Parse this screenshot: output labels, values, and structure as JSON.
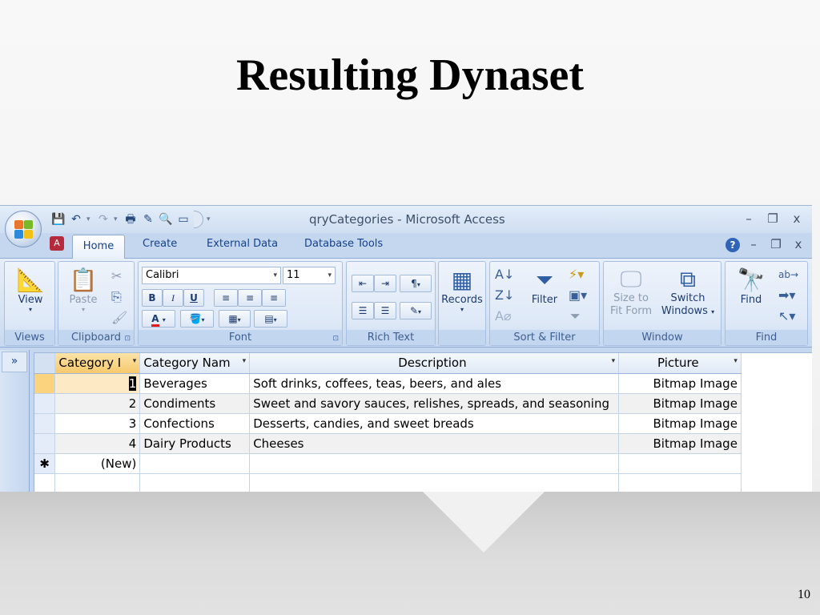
{
  "slide": {
    "title": "Resulting Dynaset",
    "page_number": "10"
  },
  "window": {
    "title": "qryCategories - Microsoft Access",
    "controls": {
      "minimize": "–",
      "restore": "❐",
      "close": "x"
    },
    "doc_controls": {
      "help": "?",
      "minimize": "–",
      "restore": "❐",
      "close": "x"
    }
  },
  "quick_access": {
    "icons": [
      "save-icon",
      "undo-icon",
      "redo-icon",
      "print-icon",
      "design-icon",
      "print-preview-icon",
      "new-icon"
    ],
    "customize_glyph": "▾"
  },
  "tabs": [
    {
      "label": "Home",
      "active": true
    },
    {
      "label": "Create"
    },
    {
      "label": "External Data"
    },
    {
      "label": "Database Tools"
    }
  ],
  "ribbon": {
    "views": {
      "label": "Views",
      "view_button": "View"
    },
    "clipboard": {
      "label": "Clipboard",
      "paste_button": "Paste"
    },
    "font": {
      "label": "Font",
      "font_name": "Calibri",
      "font_size": "11",
      "bold": "B",
      "italic": "I",
      "underline": "U",
      "font_color_glyph": "A"
    },
    "rich_text": {
      "label": "Rich Text"
    },
    "records": {
      "label": "",
      "records_button": "Records"
    },
    "sort_filter": {
      "label": "Sort & Filter",
      "filter_button": "Filter"
    },
    "window": {
      "label": "Window",
      "size_to_fit_line1": "Size to",
      "size_to_fit_line2": "Fit Form",
      "switch_line1": "Switch",
      "switch_line2": "Windows"
    },
    "find": {
      "label": "Find",
      "find_button": "Find"
    }
  },
  "nav_pane": {
    "chevron": "»"
  },
  "datasheet": {
    "columns": [
      {
        "label": "Category I"
      },
      {
        "label": "Category Nam"
      },
      {
        "label": "Description"
      },
      {
        "label": "Picture"
      }
    ],
    "rows": [
      {
        "id": "1",
        "name": "Beverages",
        "description": "Soft drinks, coffees, teas, beers, and ales",
        "picture": "Bitmap Image"
      },
      {
        "id": "2",
        "name": "Condiments",
        "description": "Sweet and savory sauces, relishes, spreads, and seasoning",
        "picture": "Bitmap Image"
      },
      {
        "id": "3",
        "name": "Confections",
        "description": "Desserts, candies, and sweet breads",
        "picture": "Bitmap Image"
      },
      {
        "id": "4",
        "name": "Dairy Products",
        "description": "Cheeses",
        "picture": "Bitmap Image"
      }
    ],
    "new_row": {
      "marker": "✱",
      "label": "(New)"
    }
  }
}
